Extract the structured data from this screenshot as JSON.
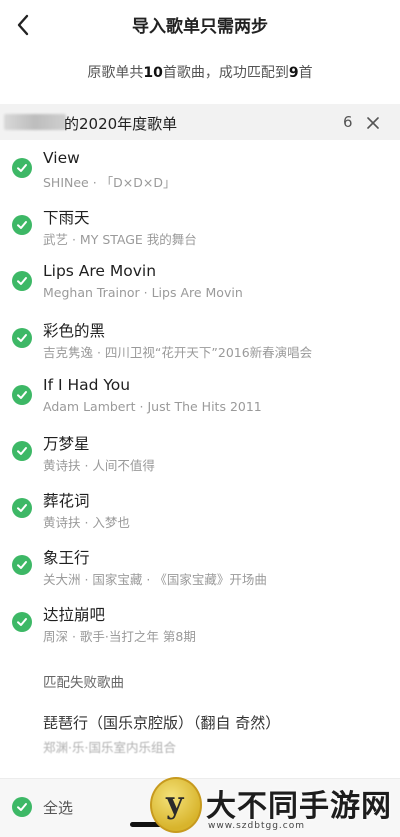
{
  "nav": {
    "title": "导入歌单只需两步"
  },
  "summary": {
    "prefix": "原歌单共",
    "total": "10",
    "middle": "首歌曲，成功匹配到",
    "matched": "9",
    "suffix": "首"
  },
  "playlist": {
    "name": "的2020年度歌单",
    "count": "6"
  },
  "songs": [
    {
      "title": "View",
      "sub": "SHINee · 「D×D×D」"
    },
    {
      "title": "下雨天",
      "sub": "武艺 · MY STAGE 我的舞台"
    },
    {
      "title": "Lips Are Movin",
      "sub": "Meghan Trainor · Lips Are Movin"
    },
    {
      "title": "彩色的黑",
      "sub": "吉克隽逸 · 四川卫视“花开天下”2016新春演唱会"
    },
    {
      "title": "If I Had You",
      "sub": "Adam Lambert · Just The Hits 2011"
    },
    {
      "title": "万梦星",
      "sub": "黄诗扶 · 人间不值得"
    },
    {
      "title": "葬花词",
      "sub": "黄诗扶 · 入梦也"
    },
    {
      "title": "象王行",
      "sub": "关大洲 · 国家宝藏 · 《国家宝藏》开场曲"
    },
    {
      "title": "达拉崩吧",
      "sub": "周深 · 歌手·当打之年 第8期"
    }
  ],
  "failed": {
    "header": "匹配失败歌曲",
    "title": "琵琶行（国乐京腔版）（翻自 奇然）",
    "sub": "郑渊·乐·国乐室内乐组合"
  },
  "footer": {
    "select_all": "全选"
  },
  "watermark": {
    "logo_char": "y",
    "text": "大不同手游网",
    "url": "www.szdbtgg.com"
  },
  "colors": {
    "check_green": "#3db866"
  },
  "icons": {
    "back": "chevron-left-icon",
    "close": "close-icon",
    "check": "check-circle-icon"
  }
}
